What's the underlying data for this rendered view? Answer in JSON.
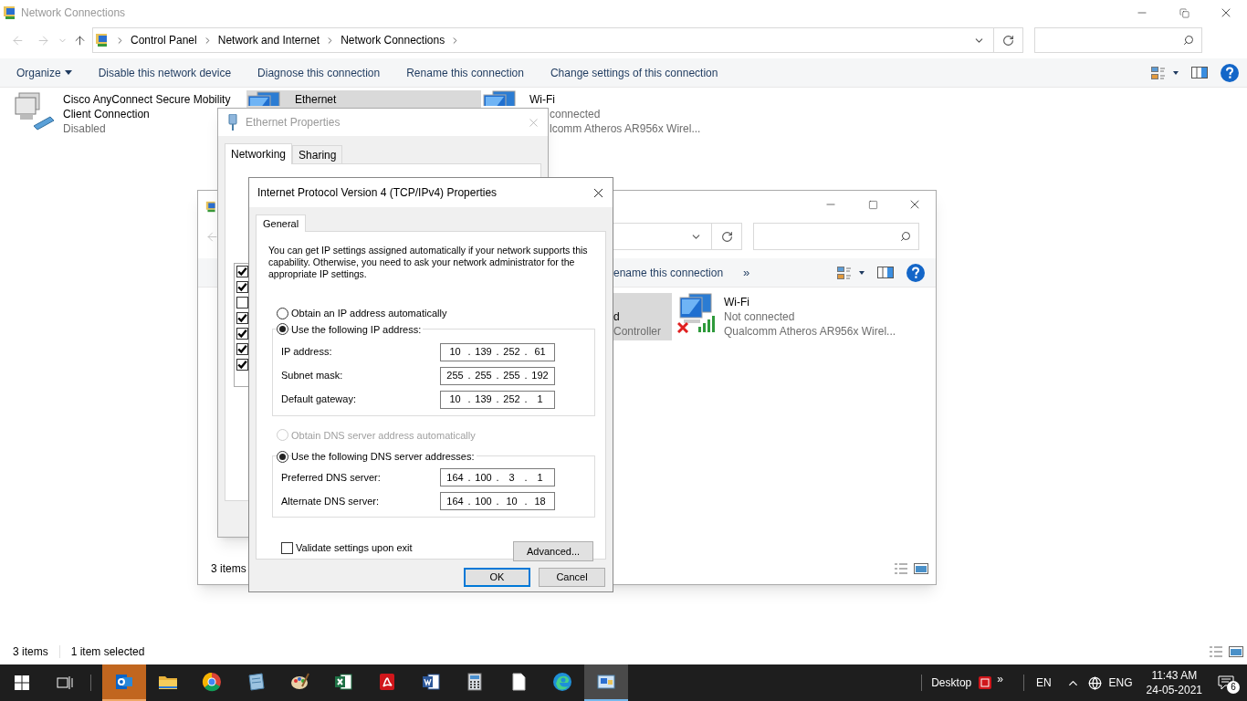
{
  "main_window": {
    "title": "Network Connections",
    "breadcrumb": [
      "Control Panel",
      "Network and Internet",
      "Network Connections"
    ],
    "toolbar": [
      {
        "label": "Organize",
        "kind": "menu"
      },
      {
        "label": "Disable this network device",
        "kind": "command"
      },
      {
        "label": "Diagnose this connection",
        "kind": "command"
      },
      {
        "label": "Rename this connection",
        "kind": "command"
      },
      {
        "label": "Change settings of this connection",
        "kind": "command"
      }
    ],
    "items": [
      {
        "kind": "cisco",
        "name": "Cisco AnyConnect Secure Mobility Client Connection",
        "status": "Disabled",
        "selected": false
      },
      {
        "kind": "ethernet",
        "name": "Ethernet",
        "selected": true
      },
      {
        "kind": "wifi",
        "name": "Wi-Fi",
        "status": "connected",
        "device": "lcomm Atheros AR956x Wirel...",
        "selected": false
      }
    ],
    "status_bar": {
      "count": "3 items",
      "selection": "1 item selected"
    }
  },
  "second_window": {
    "toolbar_text": "ename this connection",
    "overflow": "»",
    "items": [
      {
        "name": "d",
        "device": "Controller",
        "selected": true
      },
      {
        "kind": "wifi",
        "name": "Wi-Fi",
        "status": "Not connected",
        "device": "Qualcomm Atheros AR956x Wirel...",
        "selected": false
      }
    ],
    "status_bar": "3 items"
  },
  "ethernet_dialog": {
    "title": "Ethernet Properties",
    "tabs": [
      {
        "label": "Networking",
        "selected": true
      },
      {
        "label": "Sharing",
        "selected": false
      }
    ],
    "components": [
      {
        "checked": true
      },
      {
        "checked": true
      },
      {
        "checked": false
      },
      {
        "checked": true
      },
      {
        "checked": true
      },
      {
        "checked": true
      },
      {
        "checked": true
      }
    ]
  },
  "ipv4_dialog": {
    "title": "Internet Protocol Version 4 (TCP/IPv4) Properties",
    "tabs": [
      {
        "label": "General",
        "selected": true
      }
    ],
    "intro": "You can get IP settings assigned automatically if your network supports this capability. Otherwise, you need to ask your network administrator for the appropriate IP settings.",
    "separator": ".",
    "ip_mode": [
      {
        "label": "Obtain an IP address automatically",
        "selected": false,
        "disabled": false
      },
      {
        "label": "Use the following IP address:",
        "selected": true,
        "disabled": false
      }
    ],
    "ip_fields": [
      {
        "label": "IP address:",
        "octets": [
          "10",
          "139",
          "252",
          "61"
        ]
      },
      {
        "label": "Subnet mask:",
        "octets": [
          "255",
          "255",
          "255",
          "192"
        ]
      },
      {
        "label": "Default gateway:",
        "octets": [
          "10",
          "139",
          "252",
          "1"
        ]
      }
    ],
    "dns_mode": [
      {
        "label": "Obtain DNS server address automatically",
        "selected": false,
        "disabled": true
      },
      {
        "label": "Use the following DNS server addresses:",
        "selected": true,
        "disabled": false
      }
    ],
    "dns_fields": [
      {
        "label": "Preferred DNS server:",
        "octets": [
          "164",
          "100",
          "3",
          "1"
        ]
      },
      {
        "label": "Alternate DNS server:",
        "octets": [
          "164",
          "100",
          "10",
          "18"
        ]
      }
    ],
    "validate": {
      "label": "Validate settings upon exit",
      "checked": false
    },
    "advanced": "Advanced...",
    "footer_buttons": [
      {
        "label": "OK",
        "default": true
      },
      {
        "label": "Cancel",
        "default": false
      }
    ]
  },
  "taskbar": {
    "apps": [
      {
        "kind": "mail",
        "active": true
      },
      {
        "kind": "folder",
        "active": false
      },
      {
        "kind": "browser",
        "active": false
      },
      {
        "kind": "notebook",
        "active": false
      },
      {
        "kind": "palette",
        "active": false
      },
      {
        "kind": "sheet",
        "active": false
      },
      {
        "kind": "pdf",
        "active": false
      },
      {
        "kind": "doc",
        "active": false
      },
      {
        "kind": "calculator",
        "active": false
      },
      {
        "kind": "file",
        "active": false
      },
      {
        "kind": "edge",
        "active": false
      },
      {
        "kind": "network",
        "active": true
      }
    ],
    "desktop": "Desktop",
    "overflow": "»",
    "language": "EN",
    "input": "ENG",
    "time": "11:43 AM",
    "date": "24-05-2021",
    "notifications": "6"
  }
}
